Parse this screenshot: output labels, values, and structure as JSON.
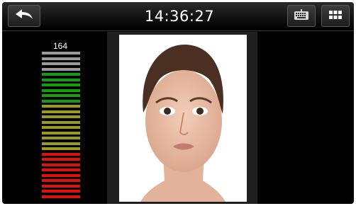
{
  "header": {
    "time": "14:36:27",
    "back_icon": "back-arrow-icon",
    "keyboard_icon": "keyboard-icon",
    "menu_icon": "grid-menu-icon"
  },
  "meter": {
    "value_label": "164",
    "total_segments": 28,
    "filled_segments": 24,
    "segment_colors": {
      "inactive": "#9a9a9a",
      "green": "#0fa00f",
      "olive": "#9a9a1c",
      "red": "#e01010"
    },
    "segment_groups": [
      "inactive",
      "inactive",
      "inactive",
      "inactive",
      "green",
      "green",
      "green",
      "green",
      "green",
      "green",
      "olive",
      "olive",
      "olive",
      "olive",
      "olive",
      "olive",
      "olive",
      "olive",
      "olive",
      "red",
      "red",
      "red",
      "red",
      "red",
      "red",
      "red",
      "red",
      "red"
    ]
  },
  "photo": {
    "subject": "face-portrait",
    "background": "#ffffff"
  }
}
